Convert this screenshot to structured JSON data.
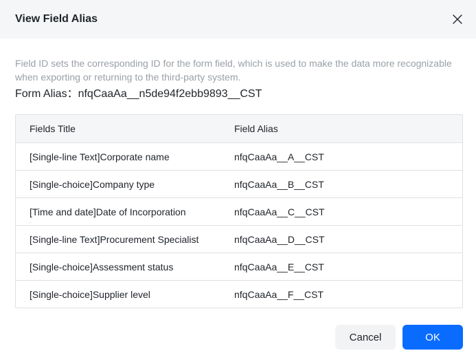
{
  "dialog": {
    "title": "View Field Alias",
    "close_icon": "close-icon",
    "description": "Field ID sets the corresponding ID for the form field, which is used to make the data more recognizable when exporting or returning to the third-party system.",
    "form_alias_label": "Form Alias：",
    "form_alias_value": "nfqCaaAa__n5de94f2ebb9893__CST"
  },
  "table": {
    "headers": {
      "title": "Fields Title",
      "alias": "Field Alias"
    },
    "rows": [
      {
        "title": "[Single-line Text]Corporate name",
        "alias": "nfqCaaAa__A__CST"
      },
      {
        "title": "[Single-choice]Company type",
        "alias": "nfqCaaAa__B__CST"
      },
      {
        "title": "[Time and date]Date of Incorporation",
        "alias": "nfqCaaAa__C__CST"
      },
      {
        "title": "[Single-line Text]Procurement Specialist",
        "alias": "nfqCaaAa__D__CST"
      },
      {
        "title": "[Single-choice]Assessment status",
        "alias": "nfqCaaAa__E__CST"
      },
      {
        "title": "[Single-choice]Supplier level",
        "alias": "nfqCaaAa__F__CST"
      }
    ]
  },
  "footer": {
    "cancel_label": "Cancel",
    "ok_label": "OK"
  },
  "colors": {
    "primary": "#0a6cff",
    "header_bg": "#f5f6f7",
    "muted_text": "#9aa0a6",
    "border": "#dee0e3"
  }
}
